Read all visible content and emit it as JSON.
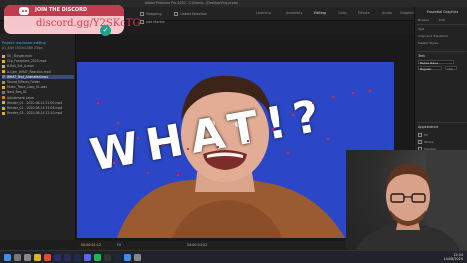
{
  "window": {
    "title": "Adobe Premiere Pro 2020 - C:\\Users\\...\\Desktop\\Proj.prproj"
  },
  "workspaces": [
    {
      "label": "Learning",
      "active": false
    },
    {
      "label": "Assembly",
      "active": false
    },
    {
      "label": "Editing",
      "active": true
    },
    {
      "label": "Color",
      "active": false
    },
    {
      "label": "Effects",
      "active": false
    },
    {
      "label": "Audio",
      "active": false
    },
    {
      "label": "Graphics",
      "active": false
    },
    {
      "label": "Libraries",
      "active": false
    }
  ],
  "discord": {
    "join_label": "JOIN THE DISCORD",
    "link": "discord.gg/Y2SKcTG"
  },
  "toolbar": {
    "snapping_label": "Snapping",
    "linked_label": "Linked Selection",
    "marker_label": "Add Marker"
  },
  "project": {
    "name": "Project: explainer-editing",
    "sequence": "01_Edit 1920x1080 25fps",
    "items": [
      {
        "name": "00 _Stinger.mov",
        "color": "#e0ad2c",
        "selected": false
      },
      {
        "name": "Clip_Faceplant_2020.mp4",
        "color": "#e0ad2c",
        "selected": false
      },
      {
        "name": "B-Roll_Set_A.mov",
        "color": "#e0ad2c",
        "selected": false
      },
      {
        "name": "A-Cam_WHAT_Reaction.mp4",
        "color": "#e0ad2c",
        "selected": false
      },
      {
        "name": "WHAT_Text_Animated.mov",
        "color": "#4a7fe3",
        "selected": true
      },
      {
        "name": "Sound_Effects_Folder",
        "color": "#6ab04c",
        "selected": false
      },
      {
        "name": "Music_Track_Loop_01.wav",
        "color": "#e0ad2c",
        "selected": false
      },
      {
        "name": "Nest_Seq_01",
        "color": "#9b59b6",
        "selected": false
      },
      {
        "name": "Adjustment Layer",
        "color": "#e07a2c",
        "selected": false
      },
      {
        "name": "Render_01 - 2020-08-14 12:00.mp4",
        "color": "#e0ad2c",
        "selected": false
      },
      {
        "name": "Render_02 - 2020-08-14 12:05.mp4",
        "color": "#e0ad2c",
        "selected": false
      },
      {
        "name": "Render_03 - 2020-08-14 12:10.mp4",
        "color": "#e0ad2c",
        "selected": false
      }
    ]
  },
  "monitor": {
    "overlay_text": "WHAT!?",
    "timecode": "00:00:01:12",
    "fit_label": "Fit",
    "duration": "00:00:04:02"
  },
  "properties": {
    "title": "Essential Graphics",
    "tabs": [
      "Browse",
      "Edit"
    ],
    "sections": [
      "Text",
      "Align and Transform",
      "Master Styles",
      "Text",
      "Appearance",
      "Fill",
      "Stroke",
      "Shadow"
    ],
    "font": "Bebas Neue",
    "style": "Regular",
    "size": "156"
  },
  "colors": {
    "video_bg": "#2b47c7",
    "accent": "#4da7ff",
    "selection": "#3a4e70"
  },
  "taskbar": {
    "time": "12:04",
    "date": "14/08/2020",
    "apps": [
      "windows-icon",
      "search-icon",
      "taskview-icon",
      "explorer-icon",
      "chrome-icon",
      "premiere-icon",
      "aftereffects-icon",
      "photoshop-icon",
      "discord-icon",
      "spotify-icon",
      "obs-icon",
      "steam-icon",
      "mail-icon",
      "settings-icon"
    ]
  }
}
